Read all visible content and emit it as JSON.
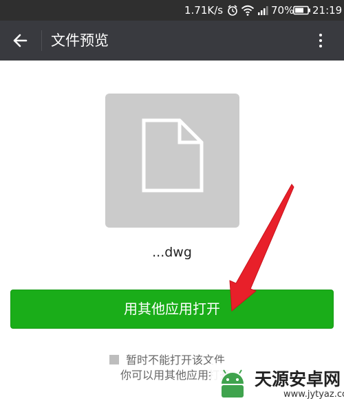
{
  "status_bar": {
    "network_speed": "1.71K/s",
    "battery_percent": "70%",
    "time": "21:19",
    "icons": [
      "alarm-icon",
      "wifi-icon",
      "signal-icon",
      "battery-icon"
    ]
  },
  "app_bar": {
    "title": "文件预览",
    "back_icon": "arrow-left-icon",
    "more_icon": "more-vertical-icon"
  },
  "file": {
    "name": "...dwg",
    "icon": "document-icon"
  },
  "open_button": {
    "label": "用其他应用打开"
  },
  "notice": {
    "line1": "暂时不能打开该文件",
    "line2": "你可以用其他应用打开"
  },
  "annotation": {
    "arrow_color": "#e8202a"
  },
  "watermark": {
    "text": "天源安卓网",
    "url": "www.jytyaz.com"
  },
  "colors": {
    "status_bar_bg": "#2f2f2f",
    "app_bar_bg": "#393a3f",
    "primary_button": "#1aad19",
    "thumbnail_bg": "#cbcbcb"
  }
}
